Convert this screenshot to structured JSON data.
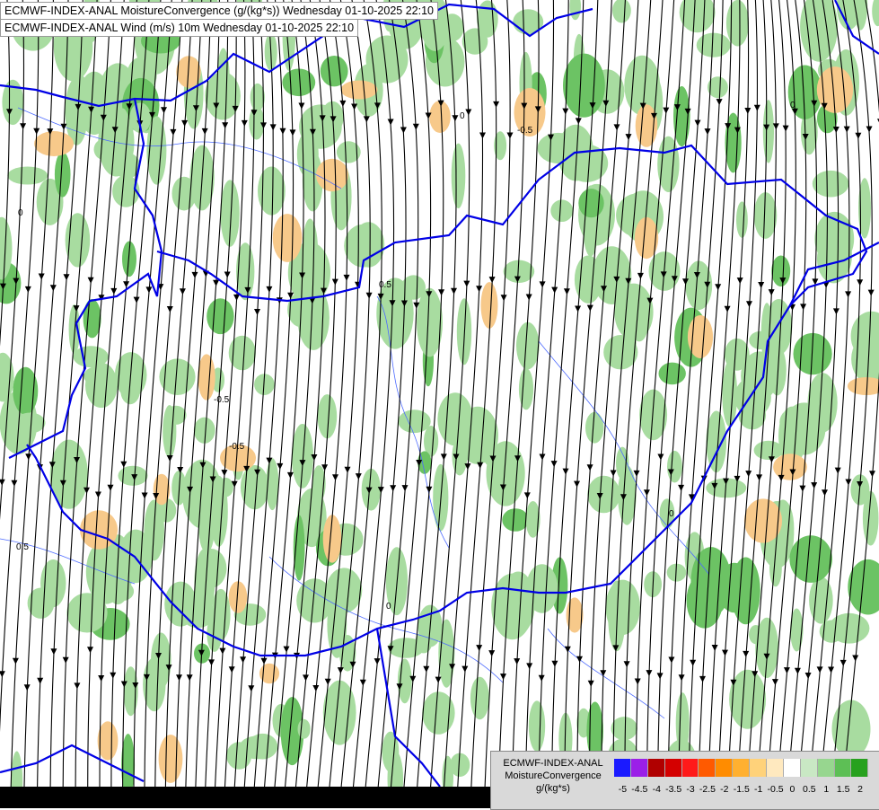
{
  "titles": {
    "line1": "ECMWF-INDEX-ANAL MoistureConvergence (g/(kg*s)) Wednesday 01-10-2025 22:10",
    "line2": "ECMWF-INDEX-ANAL Wind (m/s) 10m Wednesday 01-10-2025 22:10"
  },
  "legend": {
    "model": "ECMWF-INDEX-ANAL",
    "parameter": "MoistureConvergence",
    "unit": "g/(kg*s)",
    "ticks": [
      "-5",
      "-4.5",
      "-4",
      "-3.5",
      "-3",
      "-2.5",
      "-2",
      "-1.5",
      "-1",
      "-0.5",
      "0",
      "0.5",
      "1",
      "1.5",
      "2"
    ],
    "colors": [
      "#1a1aff",
      "#9b1fe8",
      "#b00000",
      "#d40000",
      "#ff1a1a",
      "#ff5a00",
      "#ff8c00",
      "#ffb030",
      "#ffd27a",
      "#ffe9bf",
      "#ffffff",
      "#c9e8c4",
      "#97d68f",
      "#5dbf55",
      "#27a11e"
    ]
  },
  "map_labels": {
    "contour_minus05": "-0.5",
    "contour_zero": "0",
    "contour_05": "0.5"
  },
  "colors": {
    "border": "#0000e6",
    "river": "#4d6bff",
    "streamline": "#000000",
    "convergence_green": "#a8dca0",
    "divergence_orange": "#f7c98a"
  }
}
